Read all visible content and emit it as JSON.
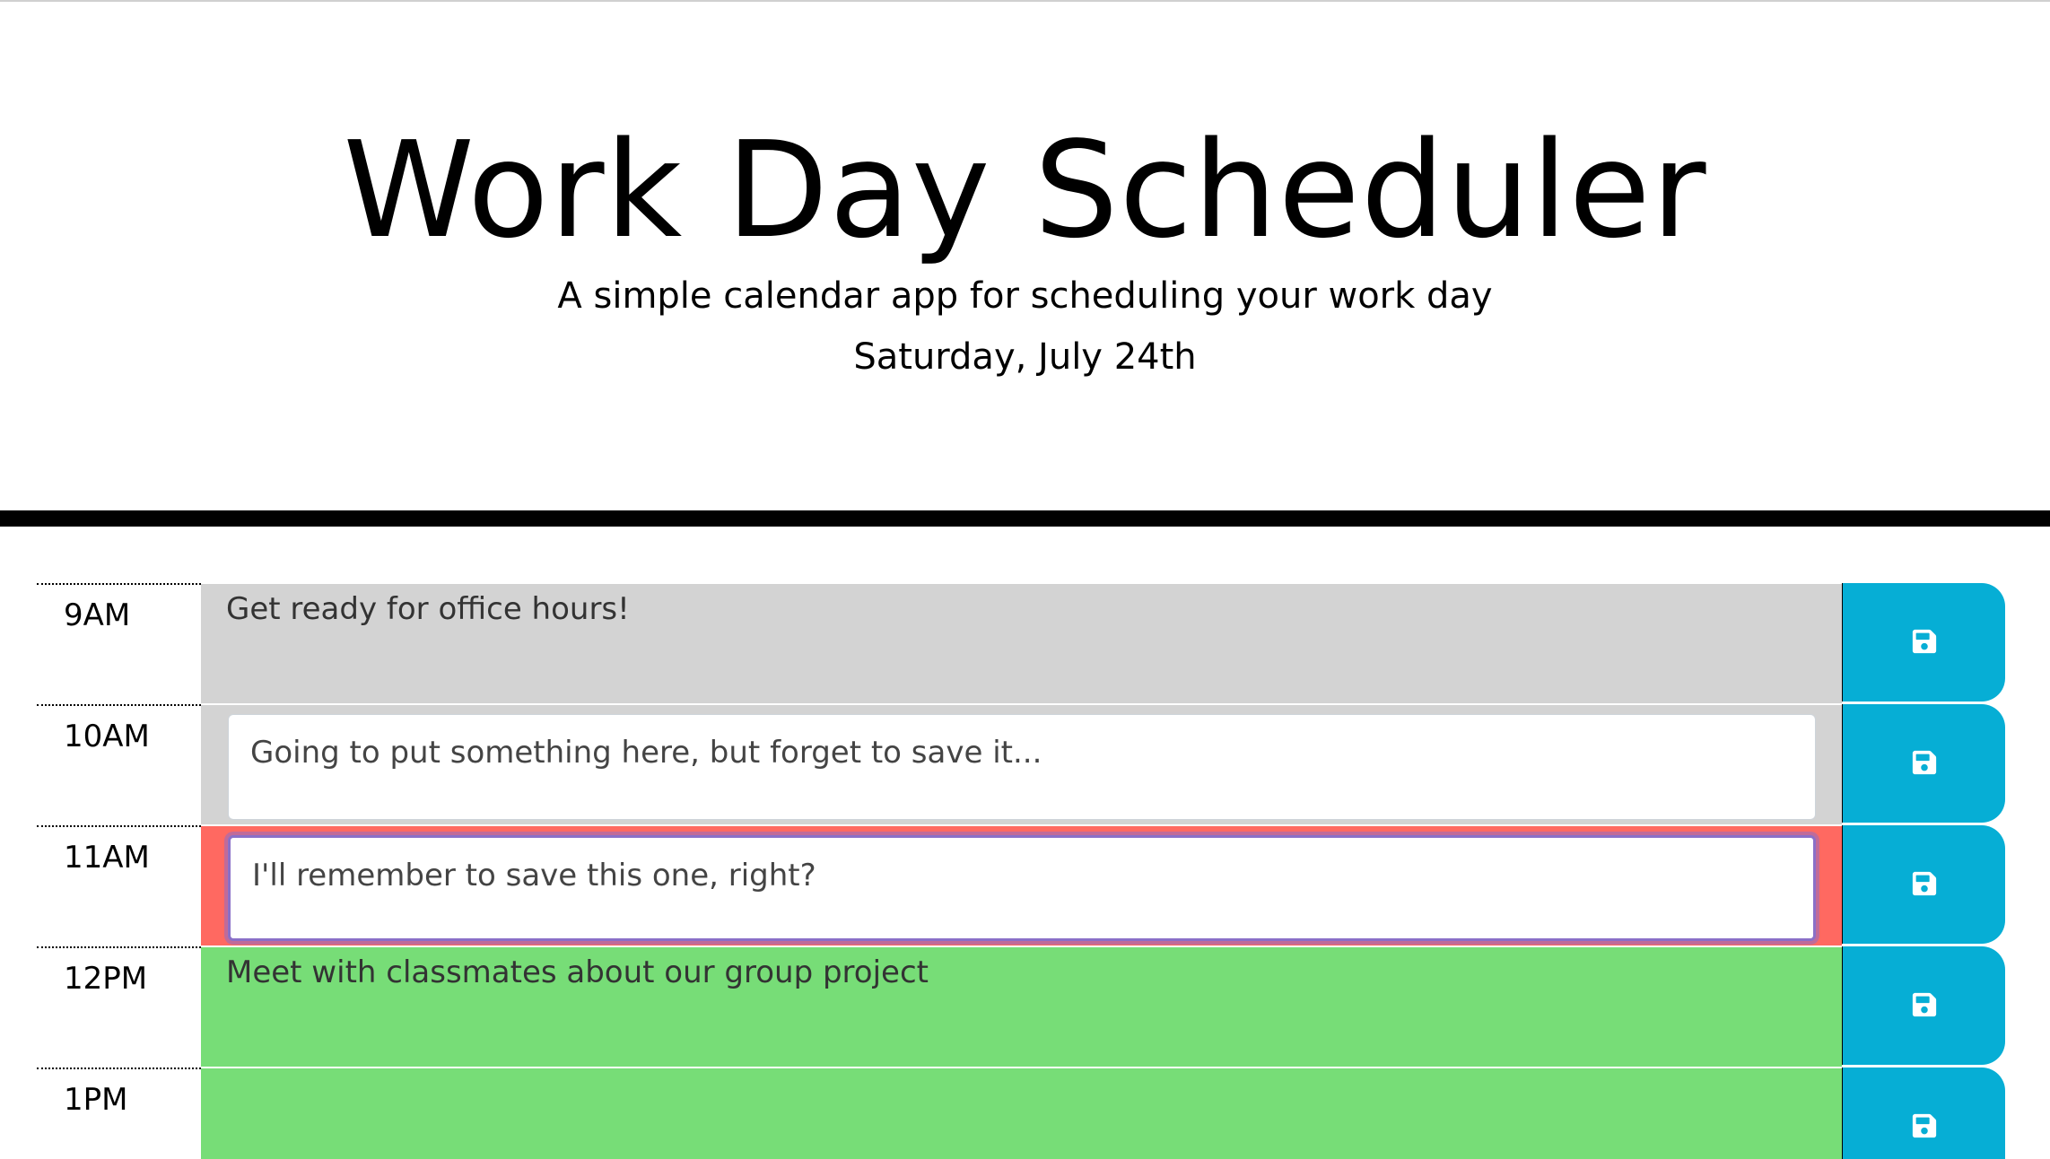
{
  "header": {
    "title": "Work Day Scheduler",
    "subtitle": "A simple calendar app for scheduling your work day",
    "current_day": "Saturday, July 24th"
  },
  "colors": {
    "past": "#d3d3d3",
    "present": "#ff6961",
    "future": "#77dd77",
    "save_button": "#06aed5"
  },
  "timeblocks": [
    {
      "hour": "9AM",
      "text": "Get ready for office hours!",
      "state": "past",
      "icon": "save-icon"
    },
    {
      "hour": "10AM",
      "text": "Going to put something here, but forget to save it...",
      "state": "past",
      "icon": "save-icon"
    },
    {
      "hour": "11AM",
      "text": "I'll remember to save this one, right?",
      "state": "present",
      "icon": "save-icon"
    },
    {
      "hour": "12PM",
      "text": "Meet with classmates about our group project",
      "state": "future",
      "icon": "save-icon"
    },
    {
      "hour": "1PM",
      "text": "",
      "state": "future",
      "icon": "save-icon"
    }
  ]
}
